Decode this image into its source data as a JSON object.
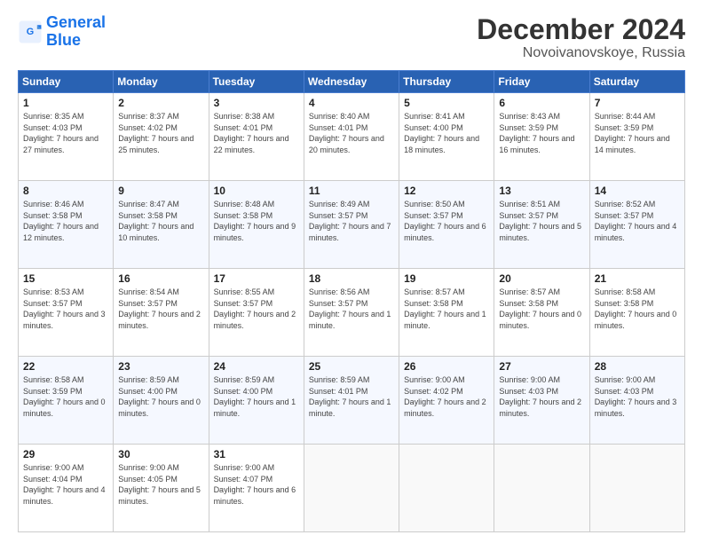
{
  "logo": {
    "line1": "General",
    "line2": "Blue"
  },
  "title": "December 2024",
  "subtitle": "Novoivanovskoye, Russia",
  "days_header": [
    "Sunday",
    "Monday",
    "Tuesday",
    "Wednesday",
    "Thursday",
    "Friday",
    "Saturday"
  ],
  "weeks": [
    [
      {
        "day": "1",
        "sunrise": "8:35 AM",
        "sunset": "4:03 PM",
        "daylight": "7 hours and 27 minutes."
      },
      {
        "day": "2",
        "sunrise": "8:37 AM",
        "sunset": "4:02 PM",
        "daylight": "7 hours and 25 minutes."
      },
      {
        "day": "3",
        "sunrise": "8:38 AM",
        "sunset": "4:01 PM",
        "daylight": "7 hours and 22 minutes."
      },
      {
        "day": "4",
        "sunrise": "8:40 AM",
        "sunset": "4:01 PM",
        "daylight": "7 hours and 20 minutes."
      },
      {
        "day": "5",
        "sunrise": "8:41 AM",
        "sunset": "4:00 PM",
        "daylight": "7 hours and 18 minutes."
      },
      {
        "day": "6",
        "sunrise": "8:43 AM",
        "sunset": "3:59 PM",
        "daylight": "7 hours and 16 minutes."
      },
      {
        "day": "7",
        "sunrise": "8:44 AM",
        "sunset": "3:59 PM",
        "daylight": "7 hours and 14 minutes."
      }
    ],
    [
      {
        "day": "8",
        "sunrise": "8:46 AM",
        "sunset": "3:58 PM",
        "daylight": "7 hours and 12 minutes."
      },
      {
        "day": "9",
        "sunrise": "8:47 AM",
        "sunset": "3:58 PM",
        "daylight": "7 hours and 10 minutes."
      },
      {
        "day": "10",
        "sunrise": "8:48 AM",
        "sunset": "3:58 PM",
        "daylight": "7 hours and 9 minutes."
      },
      {
        "day": "11",
        "sunrise": "8:49 AM",
        "sunset": "3:57 PM",
        "daylight": "7 hours and 7 minutes."
      },
      {
        "day": "12",
        "sunrise": "8:50 AM",
        "sunset": "3:57 PM",
        "daylight": "7 hours and 6 minutes."
      },
      {
        "day": "13",
        "sunrise": "8:51 AM",
        "sunset": "3:57 PM",
        "daylight": "7 hours and 5 minutes."
      },
      {
        "day": "14",
        "sunrise": "8:52 AM",
        "sunset": "3:57 PM",
        "daylight": "7 hours and 4 minutes."
      }
    ],
    [
      {
        "day": "15",
        "sunrise": "8:53 AM",
        "sunset": "3:57 PM",
        "daylight": "7 hours and 3 minutes."
      },
      {
        "day": "16",
        "sunrise": "8:54 AM",
        "sunset": "3:57 PM",
        "daylight": "7 hours and 2 minutes."
      },
      {
        "day": "17",
        "sunrise": "8:55 AM",
        "sunset": "3:57 PM",
        "daylight": "7 hours and 2 minutes."
      },
      {
        "day": "18",
        "sunrise": "8:56 AM",
        "sunset": "3:57 PM",
        "daylight": "7 hours and 1 minute."
      },
      {
        "day": "19",
        "sunrise": "8:57 AM",
        "sunset": "3:58 PM",
        "daylight": "7 hours and 1 minute."
      },
      {
        "day": "20",
        "sunrise": "8:57 AM",
        "sunset": "3:58 PM",
        "daylight": "7 hours and 0 minutes."
      },
      {
        "day": "21",
        "sunrise": "8:58 AM",
        "sunset": "3:58 PM",
        "daylight": "7 hours and 0 minutes."
      }
    ],
    [
      {
        "day": "22",
        "sunrise": "8:58 AM",
        "sunset": "3:59 PM",
        "daylight": "7 hours and 0 minutes."
      },
      {
        "day": "23",
        "sunrise": "8:59 AM",
        "sunset": "4:00 PM",
        "daylight": "7 hours and 0 minutes."
      },
      {
        "day": "24",
        "sunrise": "8:59 AM",
        "sunset": "4:00 PM",
        "daylight": "7 hours and 1 minute."
      },
      {
        "day": "25",
        "sunrise": "8:59 AM",
        "sunset": "4:01 PM",
        "daylight": "7 hours and 1 minute."
      },
      {
        "day": "26",
        "sunrise": "9:00 AM",
        "sunset": "4:02 PM",
        "daylight": "7 hours and 2 minutes."
      },
      {
        "day": "27",
        "sunrise": "9:00 AM",
        "sunset": "4:03 PM",
        "daylight": "7 hours and 2 minutes."
      },
      {
        "day": "28",
        "sunrise": "9:00 AM",
        "sunset": "4:03 PM",
        "daylight": "7 hours and 3 minutes."
      }
    ],
    [
      {
        "day": "29",
        "sunrise": "9:00 AM",
        "sunset": "4:04 PM",
        "daylight": "7 hours and 4 minutes."
      },
      {
        "day": "30",
        "sunrise": "9:00 AM",
        "sunset": "4:05 PM",
        "daylight": "7 hours and 5 minutes."
      },
      {
        "day": "31",
        "sunrise": "9:00 AM",
        "sunset": "4:07 PM",
        "daylight": "7 hours and 6 minutes."
      },
      null,
      null,
      null,
      null
    ]
  ]
}
